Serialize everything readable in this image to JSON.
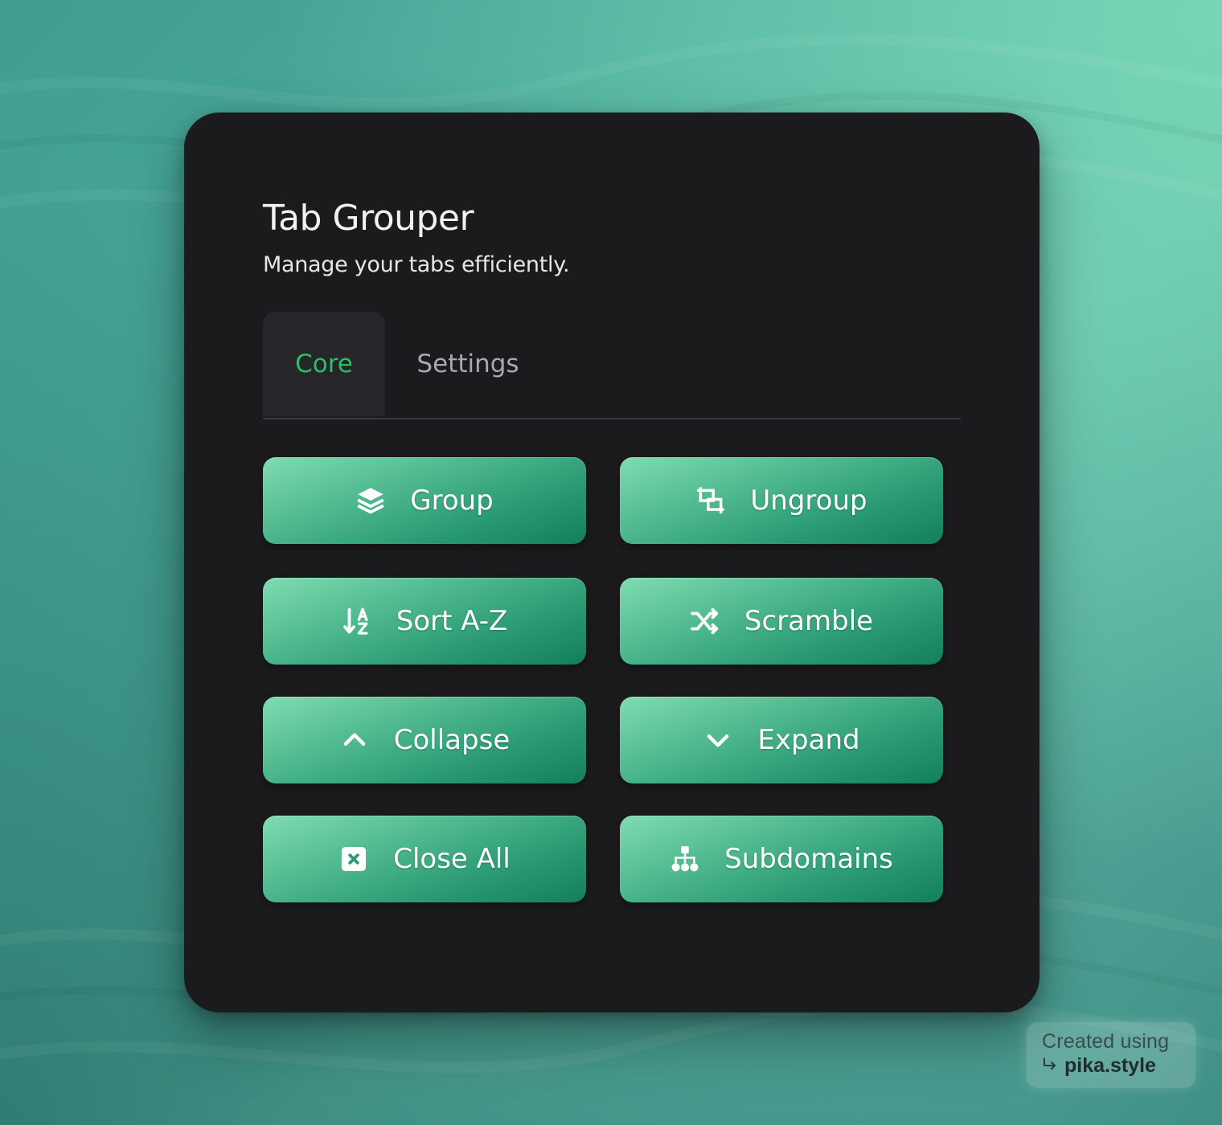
{
  "app": {
    "title": "Tab Grouper",
    "subtitle": "Manage your tabs efficiently."
  },
  "tabs": [
    {
      "label": "Core",
      "active": true
    },
    {
      "label": "Settings",
      "active": false
    }
  ],
  "actions": [
    {
      "label": "Group",
      "icon": "layers-icon"
    },
    {
      "label": "Ungroup",
      "icon": "ungroup-icon"
    },
    {
      "label": "Sort A-Z",
      "icon": "sort-az-icon"
    },
    {
      "label": "Scramble",
      "icon": "shuffle-icon"
    },
    {
      "label": "Collapse",
      "icon": "chevron-up-icon"
    },
    {
      "label": "Expand",
      "icon": "chevron-down-icon"
    },
    {
      "label": "Close All",
      "icon": "close-square-icon"
    },
    {
      "label": "Subdomains",
      "icon": "sitemap-icon"
    }
  ],
  "watermark": {
    "line1": "Created using",
    "line2": "pika.style"
  },
  "colors": {
    "accent": "#2bbf63",
    "card_background": "#1b1b1e",
    "button_gradient_start": "#7fdcb0",
    "button_gradient_end": "#137f5c"
  }
}
